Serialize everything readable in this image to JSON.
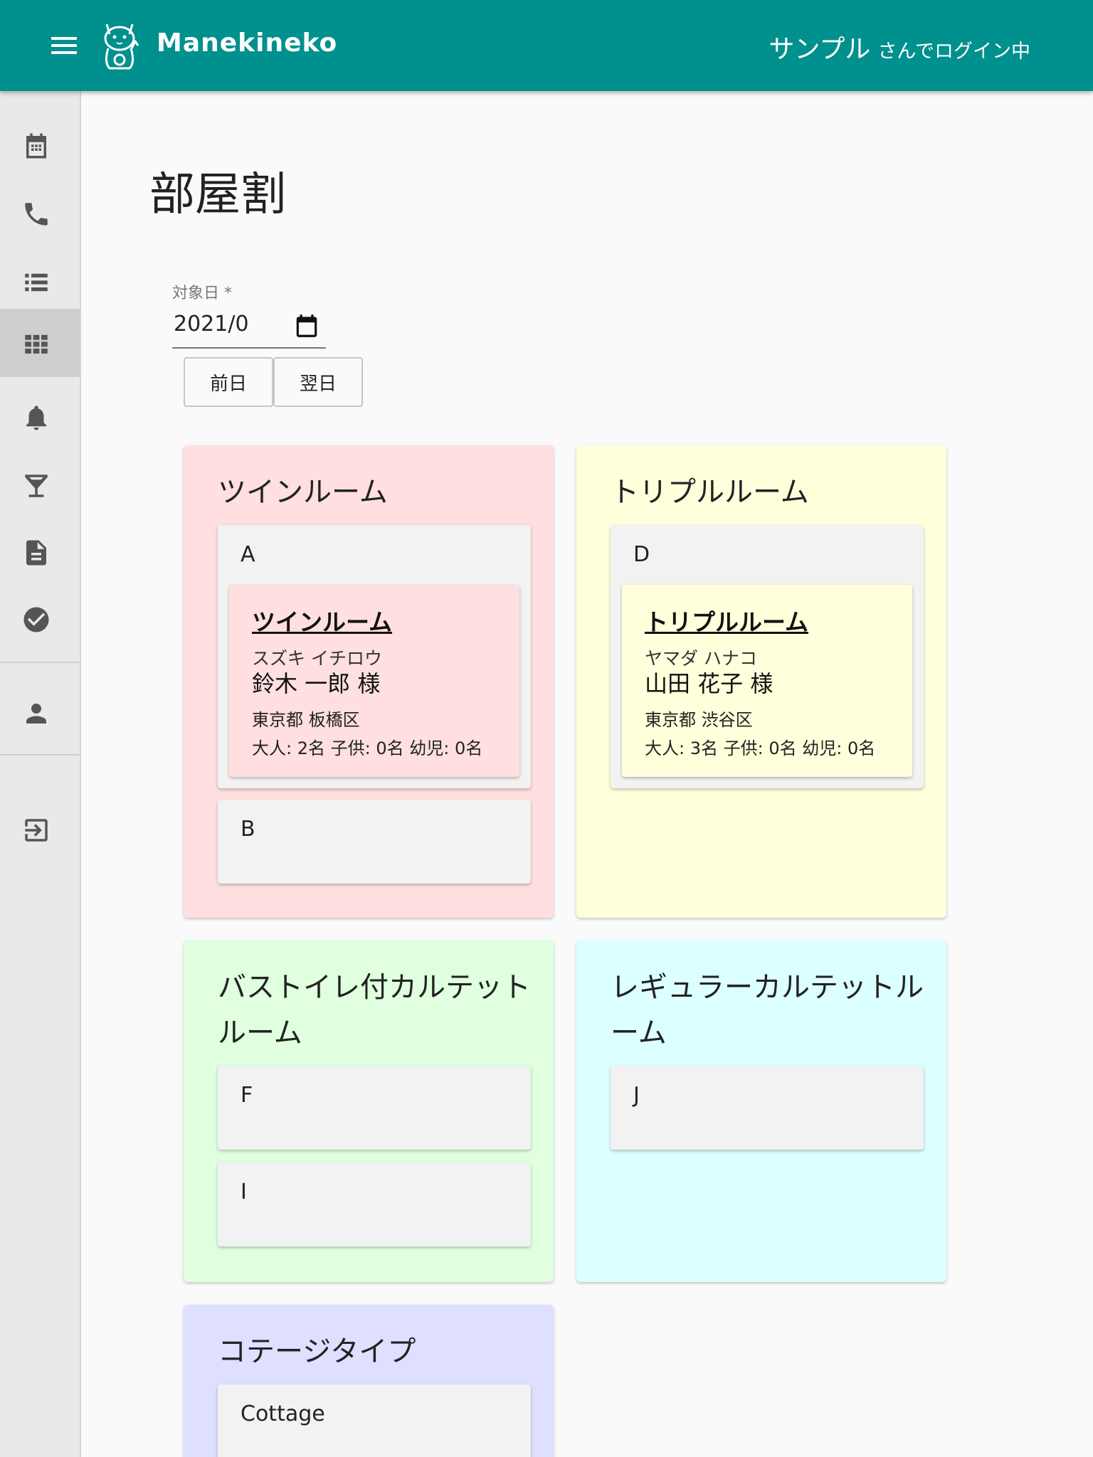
{
  "header": {
    "brand": "Manekineko",
    "user_name": "サンプル",
    "login_suffix": "さんでログイン中"
  },
  "sidebar": {
    "items": [
      {
        "icon": "calendar-icon"
      },
      {
        "icon": "phone-icon"
      },
      {
        "icon": "list-icon"
      },
      {
        "icon": "grid-icon",
        "active": true
      },
      {
        "icon": "bell-icon"
      },
      {
        "icon": "cocktail-icon"
      },
      {
        "icon": "document-icon"
      },
      {
        "icon": "check-circle-icon"
      },
      {
        "icon": "person-icon"
      },
      {
        "icon": "logout-icon"
      }
    ]
  },
  "page": {
    "title": "部屋割",
    "date_label": "対象日 *",
    "date_value": "2021/0",
    "prev_button": "前日",
    "next_button": "翌日"
  },
  "room_types": [
    {
      "name": "ツインルーム",
      "color": "#ffdfdf",
      "rooms": [
        {
          "label": "A",
          "booking": {
            "plan": "ツインルーム",
            "kana": "スズキ イチロウ",
            "name": "鈴木 一郎 様",
            "address": "東京都 板橋区",
            "counts": "大人: 2名 子供: 0名 幼児: 0名"
          }
        },
        {
          "label": "B"
        }
      ]
    },
    {
      "name": "トリプルルーム",
      "color": "#ffffdc",
      "rooms": [
        {
          "label": "D",
          "booking": {
            "plan": "トリプルルーム",
            "kana": "ヤマダ ハナコ",
            "name": "山田 花子 様",
            "address": "東京都 渋谷区",
            "counts": "大人: 3名 子供: 0名 幼児: 0名"
          }
        }
      ]
    },
    {
      "name": "バストイレ付カルテットルーム",
      "color": "#dfffdf",
      "rooms": [
        {
          "label": "F"
        },
        {
          "label": "I"
        }
      ]
    },
    {
      "name": "レギュラーカルテットルーム",
      "color": "#dcffff",
      "rooms": [
        {
          "label": "J"
        }
      ]
    },
    {
      "name": "コテージタイプ",
      "color": "#dfdfff",
      "rooms": [
        {
          "label": "Cottage"
        }
      ]
    }
  ]
}
